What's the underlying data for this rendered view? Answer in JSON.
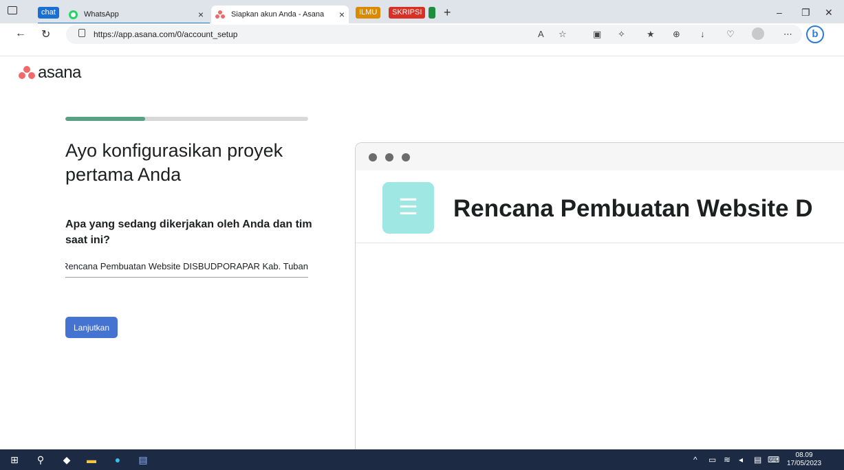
{
  "browser": {
    "tab_groups": [
      {
        "label": "chat",
        "color": "#1a6fd3"
      },
      {
        "label": "ILMU",
        "color": "#d98a00"
      },
      {
        "label": "SKRIPSI",
        "color": "#d93025"
      }
    ],
    "tabs": [
      {
        "title": "WhatsApp",
        "icon": "whatsapp-icon",
        "active": false
      },
      {
        "title": "Siapkan akun Anda - Asana",
        "icon": "asana-icon",
        "active": true
      }
    ],
    "url": "https://app.asana.com/0/account_setup",
    "tab_close_glyph": "×",
    "new_tab_glyph": "+"
  },
  "page": {
    "logo_text": "asana",
    "progress": 0.33,
    "heading": "Ayo konfigurasikan proyek pertama Anda",
    "question": "Apa yang sedang dikerjakan oleh Anda dan tim saat ini?",
    "answer_value": "Rencana Pembuatan Website DISBUDPORAPAR Kab. Tuban",
    "continue_label": "Lanjutkan",
    "preview_title": "Rencana Pembuatan Website D",
    "accent_color": "#4573d2",
    "progress_color": "#58a182",
    "project_icon_color": "#9ee7e3"
  },
  "taskbar": {
    "time": "08.09",
    "date": "17/05/2023"
  }
}
